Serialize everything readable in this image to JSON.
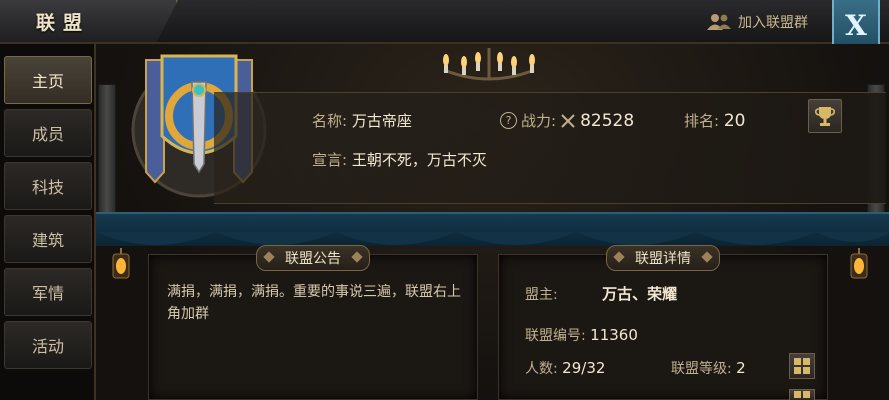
{
  "header": {
    "title": "联盟",
    "join_group_label": "加入联盟群",
    "close_label": "X"
  },
  "sidebar": {
    "tabs": [
      {
        "label": "主页",
        "active": true
      },
      {
        "label": "成员",
        "active": false
      },
      {
        "label": "科技",
        "active": false
      },
      {
        "label": "建筑",
        "active": false
      },
      {
        "label": "军情",
        "active": false
      },
      {
        "label": "活动",
        "active": false
      }
    ]
  },
  "alliance": {
    "name_label": "名称:",
    "name": "万古帝座",
    "power_label": "战力:",
    "power": "82528",
    "rank_label": "排名:",
    "rank": "20",
    "declaration_label": "宣言:",
    "declaration": "王朝不死，万古不灭"
  },
  "notice": {
    "title": "联盟公告",
    "text": "满捐，满捐，满捐。重要的事说三遍，联盟右上角加群"
  },
  "details": {
    "title": "联盟详情",
    "leader_label": "盟主:",
    "leader": "万古、荣耀",
    "id_label": "联盟编号:",
    "id": "11360",
    "members_label": "人数:",
    "members": "29/32",
    "level_label": "联盟等级:",
    "level": "2"
  },
  "colors": {
    "accent_gold": "#c0b08f",
    "curtain_blue": "#163a4f",
    "close_button": "#3a6e86"
  }
}
